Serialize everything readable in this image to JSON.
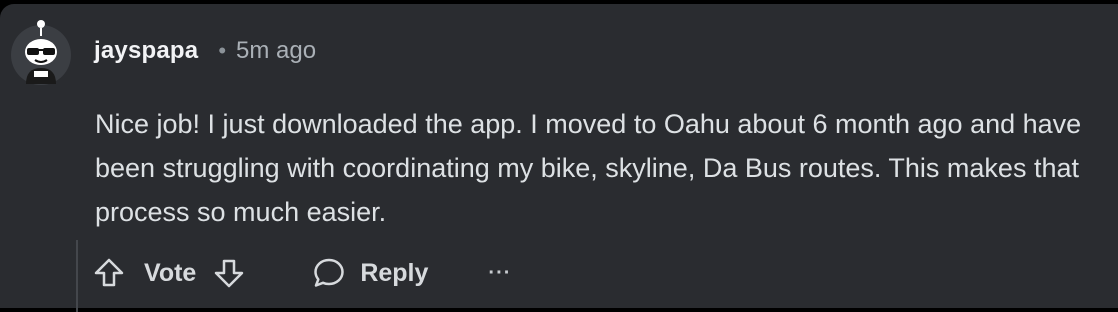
{
  "comment": {
    "username": "jayspapa",
    "separator": "•",
    "timestamp": "5m ago",
    "body": "Nice job! I just downloaded the app. I moved to Oahu about 6 month ago and have been struggling with coordinating my bike, skyline, Da Bus routes. This makes that process so much easier.",
    "avatar": "snoo-avatar-with-sunglasses"
  },
  "actions": {
    "upvote_icon": "arrow-up-outline-icon",
    "vote_label": "Vote",
    "downvote_icon": "arrow-down-outline-icon",
    "reply_icon": "speech-bubble-icon",
    "reply_label": "Reply",
    "more_label": "···"
  },
  "colors": {
    "background": "#000000",
    "card": "#2a2c30",
    "text_primary": "#f2f3f5",
    "text_body": "#dde1e4",
    "text_muted": "#aab0b6",
    "thread_line": "#44474c"
  }
}
